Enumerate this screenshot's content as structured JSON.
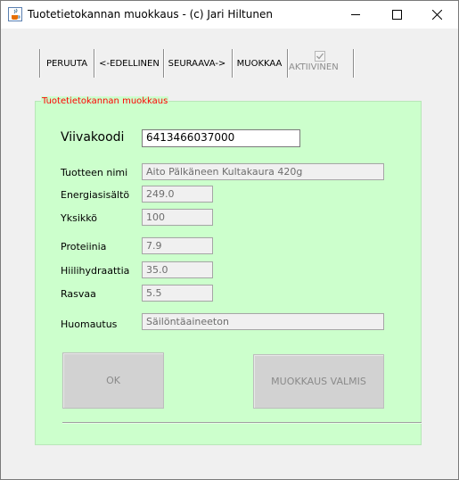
{
  "window": {
    "title": "Tuotetietokannan muokkaus - (c) Jari Hiltunen",
    "icon": "java-cup-icon",
    "controls": [
      "minimize-icon",
      "maximize-icon",
      "close-icon"
    ]
  },
  "toolbar": {
    "peruuta": "PERUUTA",
    "edellinen": "<-EDELLINEN",
    "seuraava": "SEURAAVA->",
    "muokkaa": "MUOKKAA",
    "aktiivinen_label": "AKTIIVINEN",
    "aktiivinen_checked": true
  },
  "panel": {
    "title": "Tuotetietokannan muokkaus",
    "background": "#ccffcc",
    "title_color": "#ff0000"
  },
  "form": {
    "viivakoodi": {
      "label": "Viivakoodi",
      "value": "6413466037000"
    },
    "tuotteen_nimi": {
      "label": "Tuotteen nimi",
      "value": "Aito Pälkäneen Kultakaura 420g"
    },
    "energiasisalto": {
      "label": "Energiasisältö",
      "value": "249.0"
    },
    "yksikko": {
      "label": "Yksikkö",
      "value": "100"
    },
    "proteiinia": {
      "label": "Proteiinia",
      "value": "7.9"
    },
    "hiilihydraattia": {
      "label": "Hiilihydraattia",
      "value": "35.0"
    },
    "rasvaa": {
      "label": "Rasvaa",
      "value": "5.5"
    },
    "huomautus": {
      "label": "Huomautus",
      "value": "Säilöntäaineeton"
    }
  },
  "buttons": {
    "ok": "OK",
    "muokkaus_valmis": "MUOKKAUS VALMIS"
  }
}
